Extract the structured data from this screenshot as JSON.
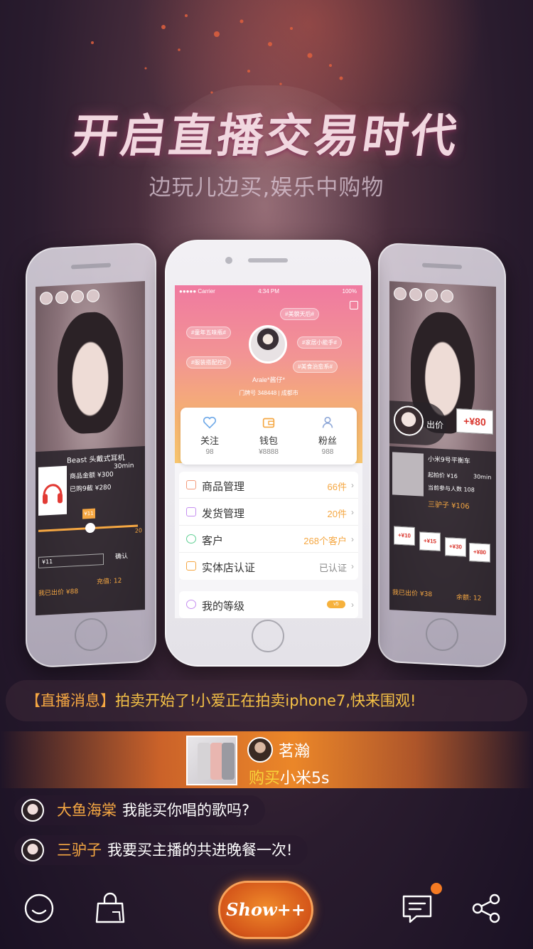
{
  "headline": "开启直播交易时代",
  "subheadline": "边玩儿边买,娱乐中购物",
  "center_phone": {
    "status": {
      "carrier": "●●●●● Carrier",
      "time": "4:34 PM",
      "battery": "100%"
    },
    "tags": [
      "#美貌天后#",
      "#童年五味瓶#",
      "#家居小能手#",
      "#服装搭配控#",
      "#美食治愈系#"
    ],
    "profile_name": "Arale*酱仔*",
    "profile_id": "门牌号  348448  |  成都市",
    "stats": [
      {
        "label": "关注",
        "value": "98"
      },
      {
        "label": "钱包",
        "value": "¥8888"
      },
      {
        "label": "粉丝",
        "value": "988"
      }
    ],
    "menu_group1": [
      {
        "label": "商品管理",
        "value": "66件"
      },
      {
        "label": "发货管理",
        "value": "20件"
      },
      {
        "label": "客户",
        "value": "268个客户"
      },
      {
        "label": "实体店认证",
        "value": "已认证"
      }
    ],
    "menu_group2": [
      {
        "label": "我的等级",
        "badge": "v5"
      }
    ]
  },
  "left_phone": {
    "product_title": "Beast 头戴式耳机",
    "price_line1": "商品金额 ¥300",
    "time_left": "30min",
    "price_line2": "已购9截 ¥280",
    "bid_tag": "¥11",
    "slider_max": "20",
    "input_value": "¥11",
    "confirm": "确认",
    "my_bid": "我已出价 ¥88",
    "recharge": "充值: 12"
  },
  "right_phone": {
    "sign_price": "+¥80",
    "bid_label": "出价",
    "product_title": "小米9号平衡车",
    "start_price": "起拍价 ¥16",
    "time_left": "30min",
    "participants": "当前参与人数 108",
    "leader": "三驴子 ¥106",
    "signs": [
      "+¥10",
      "+¥15",
      "+¥30",
      "+¥80"
    ],
    "my_bid": "我已出价 ¥38",
    "balance": "余额: 12"
  },
  "live_message": {
    "tag": "【直播消息】",
    "text": "拍卖开始了!小爱正在拍卖iphone7,快来围观!"
  },
  "gift": {
    "user": "茗瀚",
    "action": "购买",
    "item": "小米5s"
  },
  "chat": [
    {
      "name": "大鱼海棠",
      "text": "我能买你唱的歌吗?"
    },
    {
      "name": "三驴子",
      "text": "我要买主播的共进晚餐一次!"
    }
  ],
  "toolbar": {
    "show_label": "Show++"
  },
  "colors": {
    "accent": "#f5a742",
    "brand_orange": "#e0651f",
    "price_yellow": "#f6c246"
  }
}
